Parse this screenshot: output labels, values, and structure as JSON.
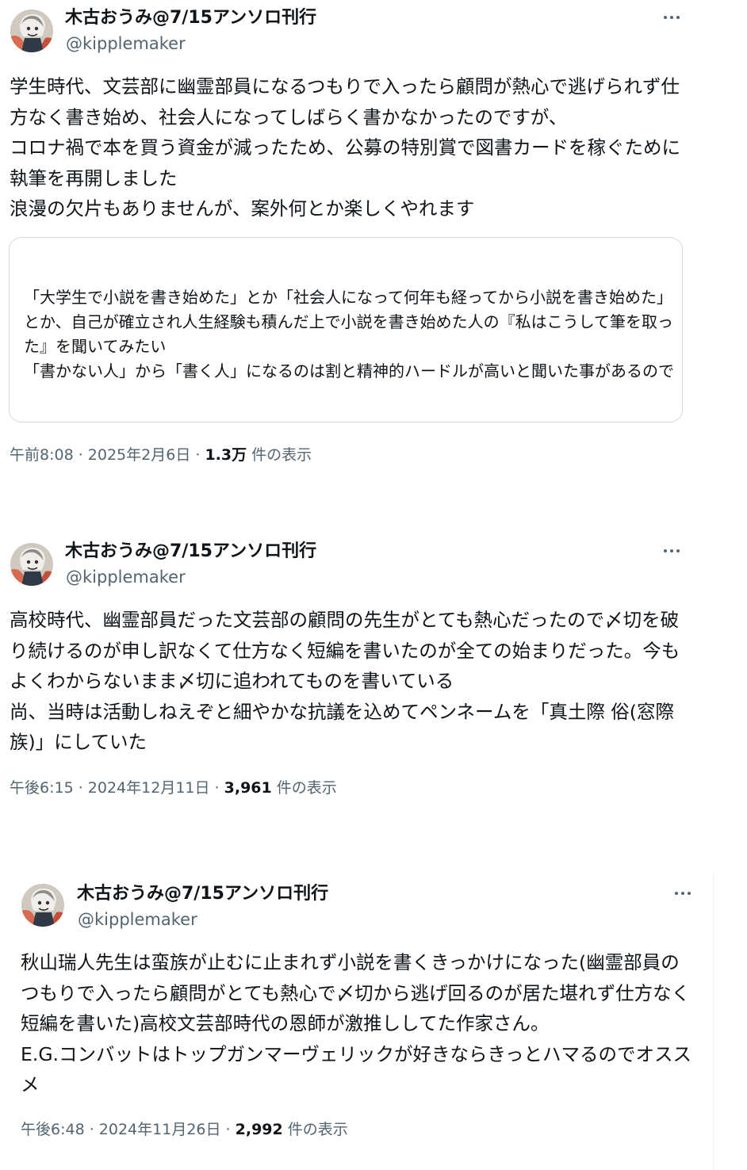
{
  "tweets": [
    {
      "display_name": "木古おうみ@7/15アンソロ刊行",
      "handle": "@kipplemaker",
      "text": "学生時代、文芸部に幽霊部員になるつもりで入ったら顧問が熱心で逃げられず仕方なく書き始め、社会人になってしばらく書かなかったのですが、\nコロナ禍で本を買う資金が減ったため、公募の特別賞で図書カードを稼ぐために執筆を再開しました\n浪漫の欠片もありませんが、案外何とか楽しくやれます",
      "quote_text": "「大学生で小説を書き始めた」とか「社会人になって何年も経ってから小説を書き始めた」とか、自己が確立され人生経験も積んだ上で小説を書き始めた人の『私はこうして筆を取った』を聞いてみたい\n「書かない人」から「書く人」になるのは割と精神的ハードルが高いと聞いた事があるので",
      "time": "午前8:08 · 2025年2月6日 · ",
      "views": "1.3万",
      "views_suffix": " 件の表示"
    },
    {
      "display_name": "木古おうみ@7/15アンソロ刊行",
      "handle": "@kipplemaker",
      "text": "高校時代、幽霊部員だった文芸部の顧問の先生がとても熱心だったので〆切を破り続けるのが申し訳なくて仕方なく短編を書いたのが全ての始まりだった。今もよくわからないまま〆切に追われてものを書いている\n尚、当時は活動しねえぞと細やかな抗議を込めてペンネームを「真土際 俗(窓際族)」にしていた",
      "time": "午後6:15 · 2024年12月11日 · ",
      "views": "3,961",
      "views_suffix": " 件の表示"
    },
    {
      "display_name": "木古おうみ@7/15アンソロ刊行",
      "handle": "@kipplemaker",
      "text": "秋山瑞人先生は蛮族が止むに止まれず小説を書くきっかけになった(幽霊部員のつもりで入ったら顧問がとても熱心で〆切から逃げ回るのが居た堪れず仕方なく短編を書いた)高校文芸部時代の恩師が激推ししてた作家さん。\nE.G.コンバットはトップガンマーヴェリックが好きならきっとハマるのでオススメ",
      "time": "午後6:48 · 2024年11月26日 · ",
      "views": "2,992",
      "views_suffix": " 件の表示"
    }
  ],
  "icons": {
    "more": "more-horizontal-icon",
    "avatar": "avatar-image"
  },
  "colors": {
    "text_primary": "#0f1419",
    "text_secondary": "#536471",
    "border": "#cfd9de"
  }
}
